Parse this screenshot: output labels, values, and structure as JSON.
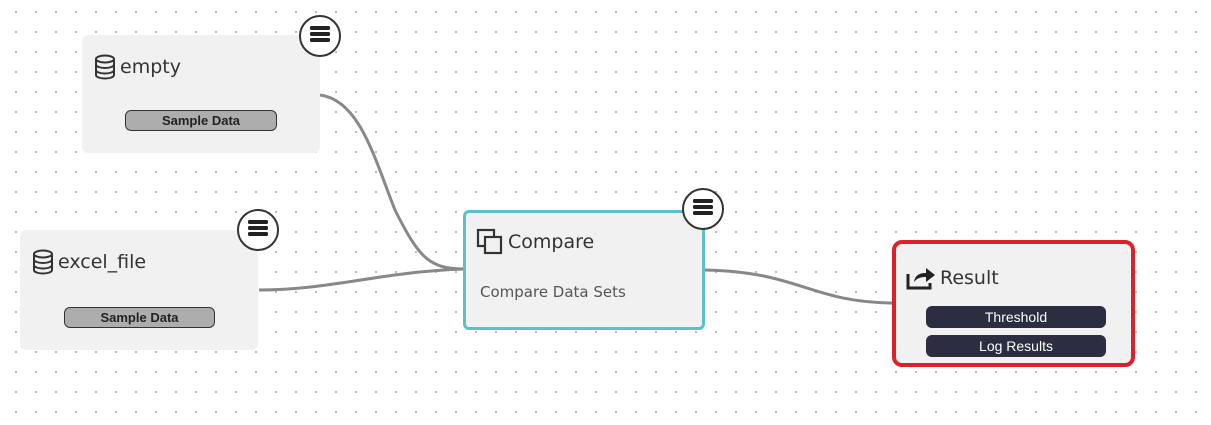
{
  "nodes": {
    "empty": {
      "title": "empty",
      "icon": "database-icon",
      "badge": "Sample Data"
    },
    "excel_file": {
      "title": "excel_file",
      "icon": "database-icon",
      "badge": "Sample Data"
    },
    "compare": {
      "title": "Compare",
      "icon": "copy-icon",
      "subtitle": "Compare Data Sets",
      "border_color": "#5bc0cc"
    },
    "result": {
      "title": "Result",
      "icon": "share-icon",
      "tags": [
        "Threshold",
        "Log Results"
      ],
      "highlight_color": "#d9222a"
    }
  },
  "menu_icon": "hamburger-icon",
  "edge_color": "#888888"
}
